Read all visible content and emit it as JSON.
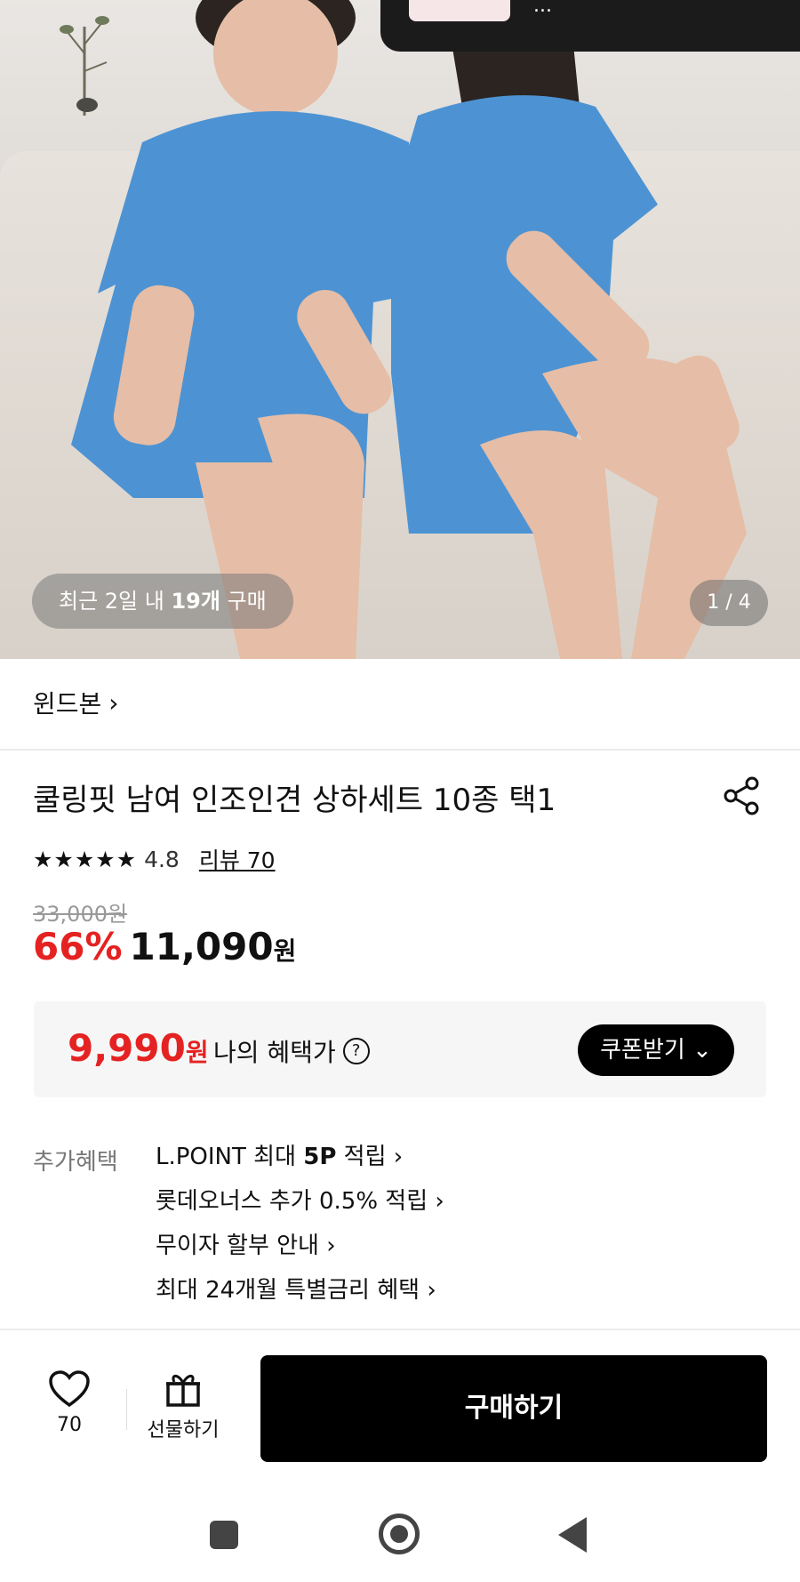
{
  "hero": {
    "toast_text": "...",
    "sold_prefix": "최근 2일 내 ",
    "sold_count": "19개",
    "sold_suffix": " 구매",
    "counter": "1 / 4"
  },
  "brand": {
    "name": "윈드본",
    "chevron": "›"
  },
  "product": {
    "title": "쿨링핏 남여 인조인견 상하세트 10종 택1",
    "stars": "★★★★★",
    "rating": "4.8",
    "review_link": "리뷰 70",
    "original_price": "33,000원",
    "discount": "66%",
    "sale_price": "11,090",
    "won": "원"
  },
  "benefit": {
    "price": "9,990",
    "won": "원",
    "label": "나의 혜택가",
    "help": "?",
    "coupon_button": "쿠폰받기 ⌄"
  },
  "extra": {
    "label": "추가혜택",
    "items": [
      {
        "pre": "L.POINT 최대 ",
        "bold": "5P",
        "post": " 적립 ›"
      },
      {
        "pre": "롯데오너스 추가 0.5% 적립 ›",
        "bold": "",
        "post": ""
      },
      {
        "pre": "무이자 할부 안내 ›",
        "bold": "",
        "post": ""
      },
      {
        "pre": "최대 24개월 특별금리 혜택 ›",
        "bold": "",
        "post": ""
      }
    ]
  },
  "actions": {
    "wish_count": "70",
    "gift_label": "선물하기",
    "buy_label": "구매하기"
  },
  "icons": {
    "heart": "heart-icon",
    "gift": "gift-icon",
    "share": "share-icon"
  },
  "colors": {
    "accent_red": "#e52222",
    "button_black": "#000000"
  }
}
